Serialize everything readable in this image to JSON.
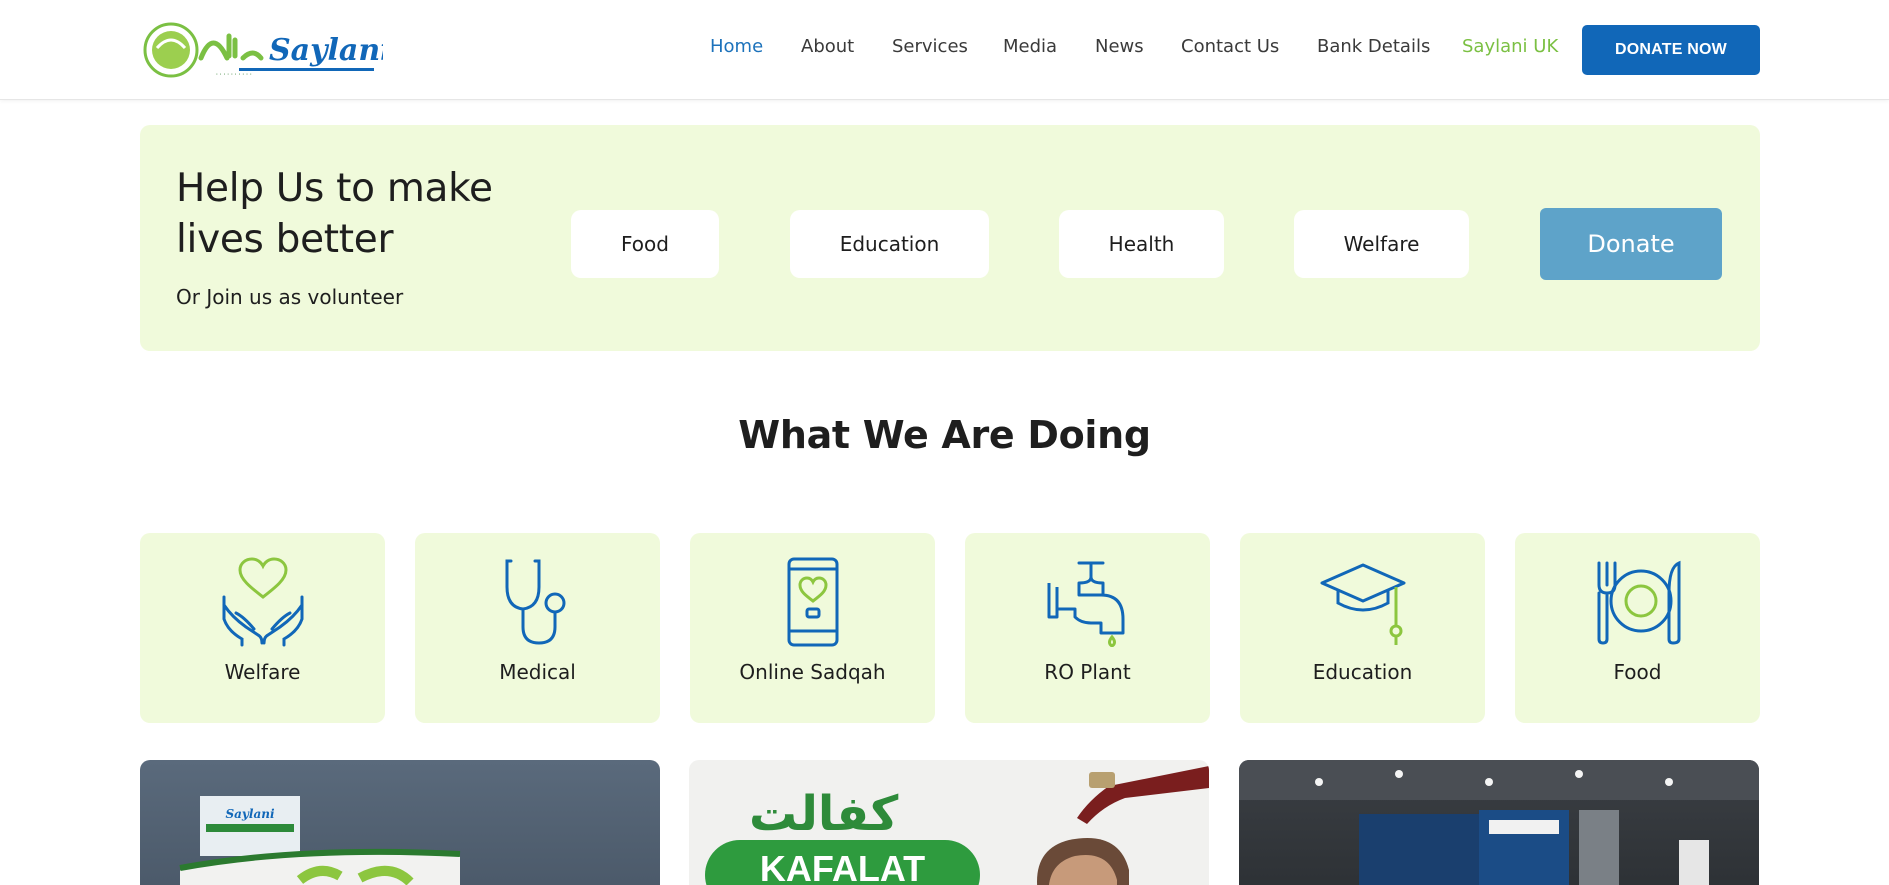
{
  "header": {
    "logo_text": "Saylani",
    "nav": [
      {
        "label": "Home"
      },
      {
        "label": "About"
      },
      {
        "label": "Services"
      },
      {
        "label": "Media"
      },
      {
        "label": "News"
      },
      {
        "label": "Contact Us"
      },
      {
        "label": "Bank Details"
      },
      {
        "label": "Saylani UK"
      }
    ],
    "donate_now_label": "DONATE NOW"
  },
  "hero": {
    "title": "Help Us to make lives better",
    "subtitle": "Or Join us as volunteer",
    "categories": [
      {
        "label": "Food"
      },
      {
        "label": "Education"
      },
      {
        "label": "Health"
      },
      {
        "label": "Welfare"
      }
    ],
    "donate_label": "Donate"
  },
  "section": {
    "title": "What We Are Doing"
  },
  "services": [
    {
      "label": "Welfare",
      "icon": "hands-heart-icon"
    },
    {
      "label": "Medical",
      "icon": "stethoscope-icon"
    },
    {
      "label": "Online Sadqah",
      "icon": "mobile-heart-icon"
    },
    {
      "label": "RO Plant",
      "icon": "water-tap-icon"
    },
    {
      "label": "Education",
      "icon": "graduation-cap-icon"
    },
    {
      "label": "Food",
      "icon": "plate-fork-knife-icon"
    }
  ],
  "image_cards": {
    "kafalat_urdu": "كفالت",
    "kafalat_en": "KAFALAT"
  },
  "colors": {
    "brand_blue": "#1167b8",
    "brand_green": "#7bc043",
    "hero_bg": "#f0fadb",
    "donate_btn": "#5ea3c9"
  }
}
